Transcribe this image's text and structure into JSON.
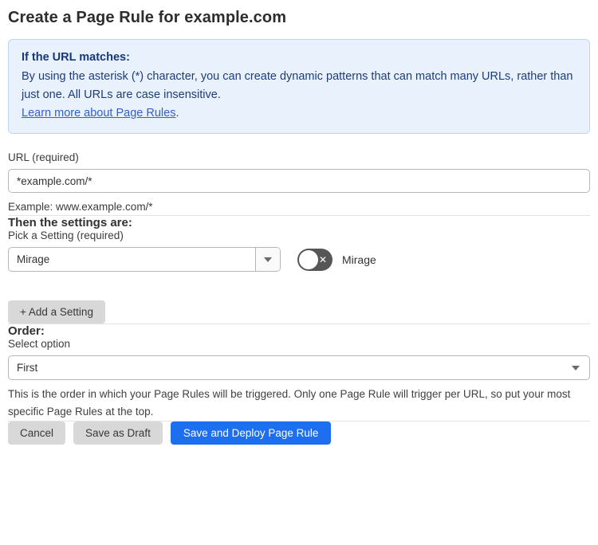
{
  "page": {
    "title": "Create a Page Rule for example.com"
  },
  "info_box": {
    "heading": "If the URL matches:",
    "body": "By using the asterisk (*) character, you can create dynamic patterns that can match many URLs, rather than just one. All URLs are case insensitive.",
    "link_label": "Learn more about Page Rules",
    "link_suffix": "."
  },
  "url_field": {
    "label": "URL (required)",
    "value": "*example.com/*",
    "helper": "Example: www.example.com/*"
  },
  "settings_section": {
    "heading": "Then the settings are:",
    "setting_label": "Pick a Setting (required)",
    "setting_value": "Mirage",
    "toggle_label": "Mirage",
    "toggle_state": "off",
    "add_button_label": "+ Add a Setting"
  },
  "order_section": {
    "heading": "Order:",
    "label": "Select option",
    "value": "First",
    "helper": "This is the order in which your Page Rules will be triggered. Only one Page Rule will trigger per URL, so put your most specific Page Rules at the top."
  },
  "footer": {
    "cancel_label": "Cancel",
    "save_draft_label": "Save as Draft",
    "deploy_label": "Save and Deploy Page Rule"
  },
  "colors": {
    "accent_blue": "#1d6ff0",
    "info_background": "#e9f2fc",
    "info_border": "#bcd7f2",
    "info_text": "#1e3d78",
    "link_blue": "#3060c8",
    "toggle_off_gray": "#565656",
    "button_gray": "#d8d8d8"
  }
}
